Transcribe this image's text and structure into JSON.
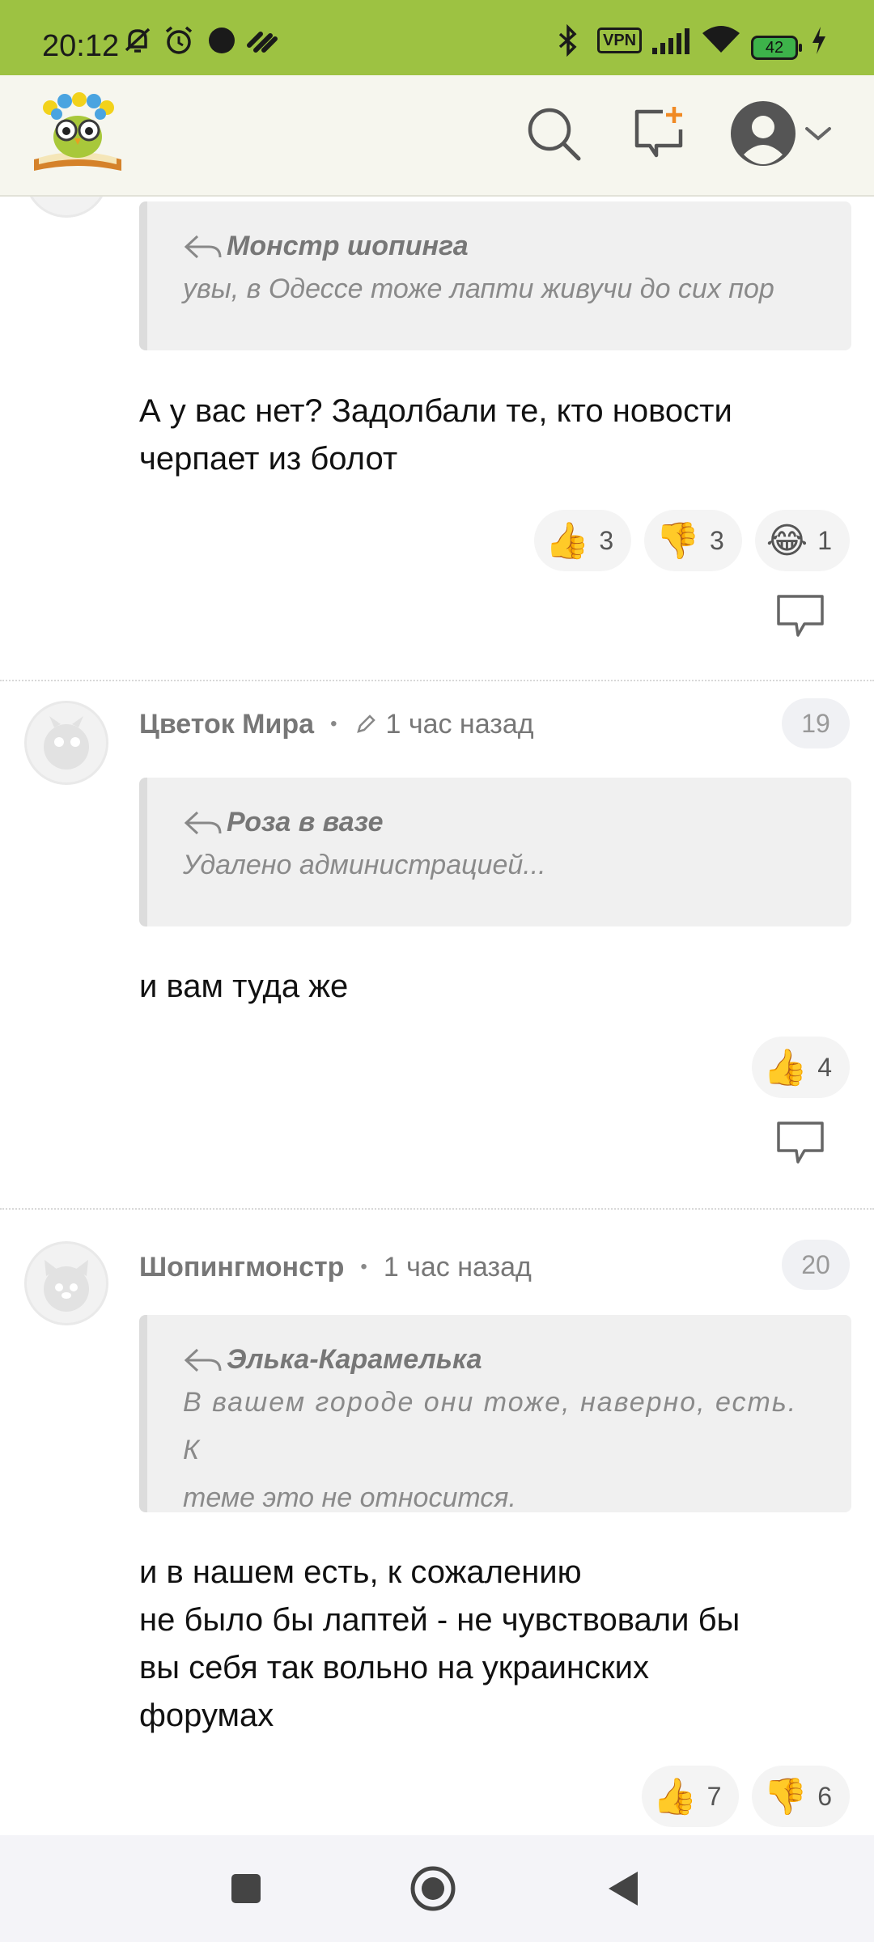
{
  "status_bar": {
    "time": "20:12",
    "battery": "42",
    "icons": [
      "muted-bell-icon",
      "alarm-icon",
      "dot-icon",
      "app-icon",
      "bluetooth-icon",
      "vpn-icon",
      "signal-icon",
      "wifi-icon",
      "battery-icon",
      "charging-icon"
    ],
    "vpn_label": "VPN"
  },
  "header": {
    "logo": "owl-book-logo",
    "icons": [
      "search-icon",
      "new-post-icon",
      "avatar-icon",
      "chevron-down-icon"
    ],
    "accent": "#f08a24"
  },
  "comments": [
    {
      "quote_author": "Монстр шопинга",
      "quote_text": "увы, в Одессе тоже лапти живучи до сих пор",
      "text_lines": [
        "А у вас нет? Задолбали те, кто новости",
        "черпает из болот"
      ],
      "reactions": [
        {
          "emoji": "👍",
          "count": "3"
        },
        {
          "emoji": "👎",
          "count": "3"
        },
        {
          "emoji": "😂",
          "count": "1"
        }
      ]
    },
    {
      "author": "Цветок Мира",
      "time": "1 час назад",
      "edited": true,
      "number": "19",
      "quote_author": "Роза в вазе",
      "quote_text": "Удалено администрацией...",
      "text_lines": [
        "и вам туда же"
      ],
      "reactions": [
        {
          "emoji": "👍",
          "count": "4"
        }
      ]
    },
    {
      "author": "Шопингмонстр",
      "time": "1 час назад",
      "number": "20",
      "quote_author": "Элька-Карамелька",
      "quote_text_lines": [
        "В вашем городе они тоже, наверно, есть. К",
        "теме это не относится."
      ],
      "text_lines": [
        "и в нашем есть, к сожалению",
        "не было бы лаптей - не чувствовали бы",
        "вы себя так вольно на украинских",
        "форумах"
      ],
      "reactions": [
        {
          "emoji": "👍",
          "count": "7"
        },
        {
          "emoji": "👎",
          "count": "6"
        }
      ]
    }
  ],
  "nav_bar": {
    "icons": [
      "recents-square-icon",
      "home-circle-icon",
      "back-triangle-icon"
    ]
  }
}
